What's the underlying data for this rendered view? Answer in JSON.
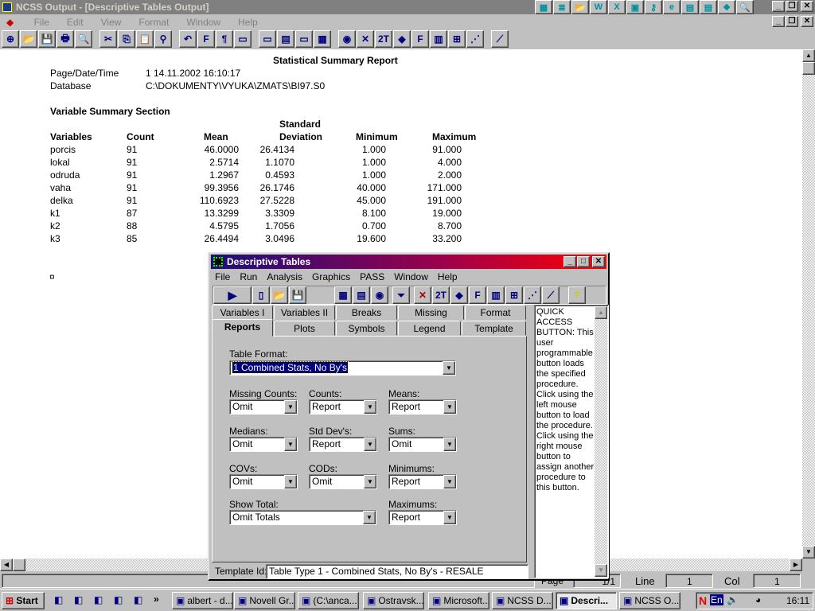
{
  "app": {
    "title": "NCSS Output - [Descriptive Tables Output]",
    "menu": [
      "File",
      "Edit",
      "View",
      "Format",
      "Window",
      "Help"
    ],
    "toolbar_icons": [
      "new-icon",
      "open-icon",
      "save-icon",
      "print-icon",
      "print-preview-icon",
      "cut-icon",
      "copy-icon",
      "paste-icon",
      "find-icon",
      "undo-icon",
      "font-icon",
      "paragraph-icon",
      "ruler-icon",
      "table-icon",
      "page-icon",
      "data-icon",
      "spreadsheet-icon",
      "globe-icon",
      "close-x-icon",
      "two-sample-icon",
      "mra-icon",
      "freq-icon",
      "bar-chart-icon",
      "box-plot-icon",
      "scatter-icon",
      "regression-icon"
    ],
    "toolbar_glyphs": [
      "⊕",
      "📂",
      "💾",
      "🖶",
      "🔍",
      "✂",
      "⎘",
      "📋",
      "⚲",
      "↶",
      "F",
      "¶",
      "▭",
      "▭",
      "▤",
      "▭",
      "▦",
      "◉",
      "✕",
      "2T",
      "◆",
      "F",
      "▥",
      "⊞",
      "⋰",
      "⟋"
    ],
    "tray_icons": [
      "colors-icon",
      "notepad-icon",
      "folder-icon",
      "word-icon",
      "excel-icon",
      "presentation-icon",
      "key-icon",
      "ie-icon",
      "folder-icon",
      "folder-icon",
      "graphics-icon",
      "search-icon"
    ],
    "tray_glyphs": [
      "▦",
      "≣",
      "📂",
      "W",
      "X",
      "▣",
      "⚷",
      "e",
      "▤",
      "▤",
      "❖",
      "🔍"
    ]
  },
  "report": {
    "title": "Statistical Summary Report",
    "meta": [
      {
        "label": "Page/Date/Time",
        "value": "1    14.11.2002 16:10:17"
      },
      {
        "label": "Database",
        "value": "C:\\DOKUMENTY\\VYUKA\\ZMATS\\BI97.S0"
      }
    ],
    "section": "Variable Summary Section",
    "headers": {
      "variables": "Variables",
      "count": "Count",
      "mean": "Mean",
      "sd_top": "Standard",
      "sd": "Deviation",
      "min": "Minimum",
      "max": "Maximum"
    },
    "rows": [
      [
        "porcis",
        "91",
        "46.0000",
        "26.4134",
        "1.000",
        "91.000"
      ],
      [
        "lokal",
        "91",
        "2.5714",
        "1.1070",
        "1.000",
        "4.000"
      ],
      [
        "odruda",
        "91",
        "1.2967",
        "0.4593",
        "1.000",
        "2.000"
      ],
      [
        "vaha",
        "91",
        "99.3956",
        "26.1746",
        "40.000",
        "171.000"
      ],
      [
        "delka",
        "91",
        "110.6923",
        "27.5228",
        "45.000",
        "191.000"
      ],
      [
        "k1",
        "87",
        "13.3299",
        "3.3309",
        "8.100",
        "19.000"
      ],
      [
        "k2",
        "88",
        "4.5795",
        "1.7056",
        "0.700",
        "8.700"
      ],
      [
        "k3",
        "85",
        "26.4494",
        "3.0496",
        "19.600",
        "33.200"
      ]
    ],
    "marker": "¤"
  },
  "dialog": {
    "title": "Descriptive Tables",
    "menu": [
      "File",
      "Run",
      "Analysis",
      "Graphics",
      "PASS",
      "Window",
      "Help"
    ],
    "tabs_back": [
      "Variables I",
      "Variables II",
      "Breaks",
      "Missing",
      "Format"
    ],
    "tabs_front": [
      "Reports",
      "Plots",
      "Symbols",
      "Legend",
      "Template"
    ],
    "active_tab": "Reports",
    "table_format": {
      "label": "Table Format:",
      "value": "1 Combined Stats, No By's"
    },
    "fields": [
      {
        "label": "Missing Counts:",
        "value": "Omit"
      },
      {
        "label": "Counts:",
        "value": "Report"
      },
      {
        "label": "Means:",
        "value": "Report"
      },
      {
        "label": "Medians:",
        "value": "Omit"
      },
      {
        "label": "Std Dev's:",
        "value": "Report"
      },
      {
        "label": "Sums:",
        "value": "Omit"
      },
      {
        "label": "COVs:",
        "value": "Omit"
      },
      {
        "label": "CODs:",
        "value": "Omit"
      },
      {
        "label": "Minimums:",
        "value": "Report"
      }
    ],
    "show_total": {
      "label": "Show Total:",
      "value": "Omit Totals"
    },
    "maximums": {
      "label": "Maximums:",
      "value": "Report"
    },
    "help_text": "QUICK ACCESS BUTTON: This user programmable button loads the specified procedure. Click using the left mouse button to load the procedure. Click using the right mouse button to assign another procedure to this button.",
    "template_label": "Template Id:",
    "template_value": "Table Type 1 - Combined Stats, No By's - RESALE"
  },
  "status": {
    "page_label": "Page",
    "page": "1/1",
    "line_label": "Line",
    "line": "1",
    "col_label": "Col",
    "col": "1"
  },
  "taskbar": {
    "start": "Start",
    "items": [
      "albert - d...",
      "Novell Gr...",
      "(C:\\anca...",
      "Ostravsk...",
      "Microsoft...",
      "NCSS D...",
      "Descri...",
      "NCSS O..."
    ],
    "active": "Descri...",
    "lang": "En",
    "clock": "16:11"
  }
}
